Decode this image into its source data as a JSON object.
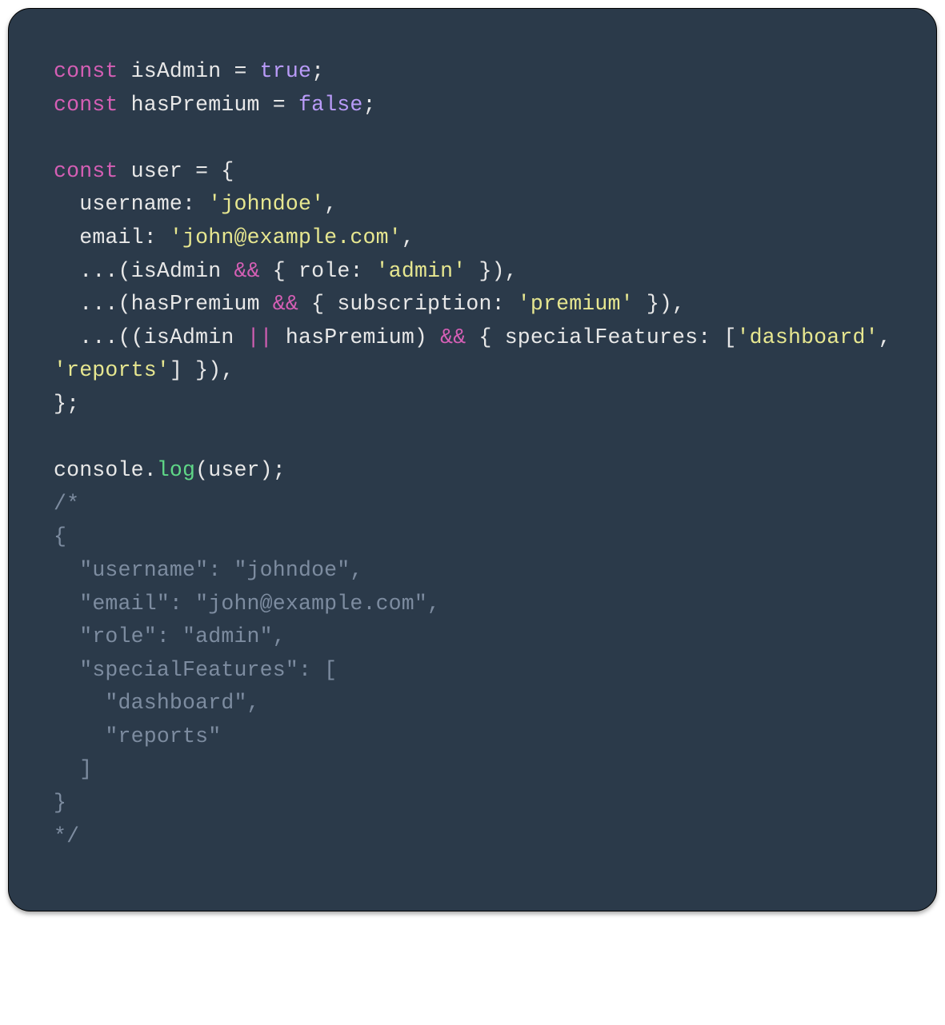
{
  "colors": {
    "background": "#2b3a4a",
    "text": "#e6e6e6",
    "keyword": "#d55fb5",
    "boolean": "#b99bf8",
    "string": "#e7e790",
    "function": "#5fd787",
    "comment": "#7d8ca0"
  },
  "code": {
    "tokens": [
      {
        "t": "kw",
        "v": "const"
      },
      {
        "t": "sp",
        "v": " "
      },
      {
        "t": "ident",
        "v": "isAdmin"
      },
      {
        "t": "sp",
        "v": " "
      },
      {
        "t": "punc",
        "v": "="
      },
      {
        "t": "sp",
        "v": " "
      },
      {
        "t": "bool",
        "v": "true"
      },
      {
        "t": "punc",
        "v": ";"
      },
      {
        "t": "nl"
      },
      {
        "t": "kw",
        "v": "const"
      },
      {
        "t": "sp",
        "v": " "
      },
      {
        "t": "ident",
        "v": "hasPremium"
      },
      {
        "t": "sp",
        "v": " "
      },
      {
        "t": "punc",
        "v": "="
      },
      {
        "t": "sp",
        "v": " "
      },
      {
        "t": "bool",
        "v": "false"
      },
      {
        "t": "punc",
        "v": ";"
      },
      {
        "t": "nl"
      },
      {
        "t": "nl"
      },
      {
        "t": "kw",
        "v": "const"
      },
      {
        "t": "sp",
        "v": " "
      },
      {
        "t": "ident",
        "v": "user"
      },
      {
        "t": "sp",
        "v": " "
      },
      {
        "t": "punc",
        "v": "="
      },
      {
        "t": "sp",
        "v": " "
      },
      {
        "t": "punc",
        "v": "{"
      },
      {
        "t": "nl"
      },
      {
        "t": "sp",
        "v": "  "
      },
      {
        "t": "ident",
        "v": "username"
      },
      {
        "t": "punc",
        "v": ":"
      },
      {
        "t": "sp",
        "v": " "
      },
      {
        "t": "str",
        "v": "'johndoe'"
      },
      {
        "t": "punc",
        "v": ","
      },
      {
        "t": "nl"
      },
      {
        "t": "sp",
        "v": "  "
      },
      {
        "t": "ident",
        "v": "email"
      },
      {
        "t": "punc",
        "v": ":"
      },
      {
        "t": "sp",
        "v": " "
      },
      {
        "t": "str",
        "v": "'john@example.com'"
      },
      {
        "t": "punc",
        "v": ","
      },
      {
        "t": "nl"
      },
      {
        "t": "sp",
        "v": "  "
      },
      {
        "t": "punc",
        "v": "...("
      },
      {
        "t": "ident",
        "v": "isAdmin"
      },
      {
        "t": "sp",
        "v": " "
      },
      {
        "t": "op",
        "v": "&&"
      },
      {
        "t": "sp",
        "v": " "
      },
      {
        "t": "punc",
        "v": "{ "
      },
      {
        "t": "ident",
        "v": "role"
      },
      {
        "t": "punc",
        "v": ":"
      },
      {
        "t": "sp",
        "v": " "
      },
      {
        "t": "str",
        "v": "'admin'"
      },
      {
        "t": "punc",
        "v": " }),"
      },
      {
        "t": "nl"
      },
      {
        "t": "sp",
        "v": "  "
      },
      {
        "t": "punc",
        "v": "...("
      },
      {
        "t": "ident",
        "v": "hasPremium"
      },
      {
        "t": "sp",
        "v": " "
      },
      {
        "t": "op",
        "v": "&&"
      },
      {
        "t": "sp",
        "v": " "
      },
      {
        "t": "punc",
        "v": "{ "
      },
      {
        "t": "ident",
        "v": "subscription"
      },
      {
        "t": "punc",
        "v": ":"
      },
      {
        "t": "sp",
        "v": " "
      },
      {
        "t": "str",
        "v": "'premium'"
      },
      {
        "t": "punc",
        "v": " }),"
      },
      {
        "t": "nl"
      },
      {
        "t": "sp",
        "v": "  "
      },
      {
        "t": "punc",
        "v": "...(("
      },
      {
        "t": "ident",
        "v": "isAdmin"
      },
      {
        "t": "sp",
        "v": " "
      },
      {
        "t": "op",
        "v": "||"
      },
      {
        "t": "sp",
        "v": " "
      },
      {
        "t": "ident",
        "v": "hasPremium"
      },
      {
        "t": "punc",
        "v": ")"
      },
      {
        "t": "sp",
        "v": " "
      },
      {
        "t": "op",
        "v": "&&"
      },
      {
        "t": "sp",
        "v": " "
      },
      {
        "t": "punc",
        "v": "{ "
      },
      {
        "t": "ident",
        "v": "specialFeatures"
      },
      {
        "t": "punc",
        "v": ":"
      },
      {
        "t": "sp",
        "v": " "
      },
      {
        "t": "punc",
        "v": "["
      },
      {
        "t": "str",
        "v": "'dashboard'"
      },
      {
        "t": "punc",
        "v": ", "
      },
      {
        "t": "str",
        "v": "'reports'"
      },
      {
        "t": "punc",
        "v": "] }),"
      },
      {
        "t": "nl"
      },
      {
        "t": "punc",
        "v": "};"
      },
      {
        "t": "nl"
      },
      {
        "t": "nl"
      },
      {
        "t": "ident",
        "v": "console"
      },
      {
        "t": "punc",
        "v": "."
      },
      {
        "t": "fn",
        "v": "log"
      },
      {
        "t": "punc",
        "v": "("
      },
      {
        "t": "ident",
        "v": "user"
      },
      {
        "t": "punc",
        "v": ");"
      },
      {
        "t": "nl"
      },
      {
        "t": "cm",
        "v": "/*"
      },
      {
        "t": "nl"
      },
      {
        "t": "cm",
        "v": "{"
      },
      {
        "t": "nl"
      },
      {
        "t": "cm",
        "v": "  \"username\": \"johndoe\","
      },
      {
        "t": "nl"
      },
      {
        "t": "cm",
        "v": "  \"email\": \"john@example.com\","
      },
      {
        "t": "nl"
      },
      {
        "t": "cm",
        "v": "  \"role\": \"admin\","
      },
      {
        "t": "nl"
      },
      {
        "t": "cm",
        "v": "  \"specialFeatures\": ["
      },
      {
        "t": "nl"
      },
      {
        "t": "cm",
        "v": "    \"dashboard\","
      },
      {
        "t": "nl"
      },
      {
        "t": "cm",
        "v": "    \"reports\""
      },
      {
        "t": "nl"
      },
      {
        "t": "cm",
        "v": "  ]"
      },
      {
        "t": "nl"
      },
      {
        "t": "cm",
        "v": "}"
      },
      {
        "t": "nl"
      },
      {
        "t": "cm",
        "v": "*/"
      }
    ]
  }
}
